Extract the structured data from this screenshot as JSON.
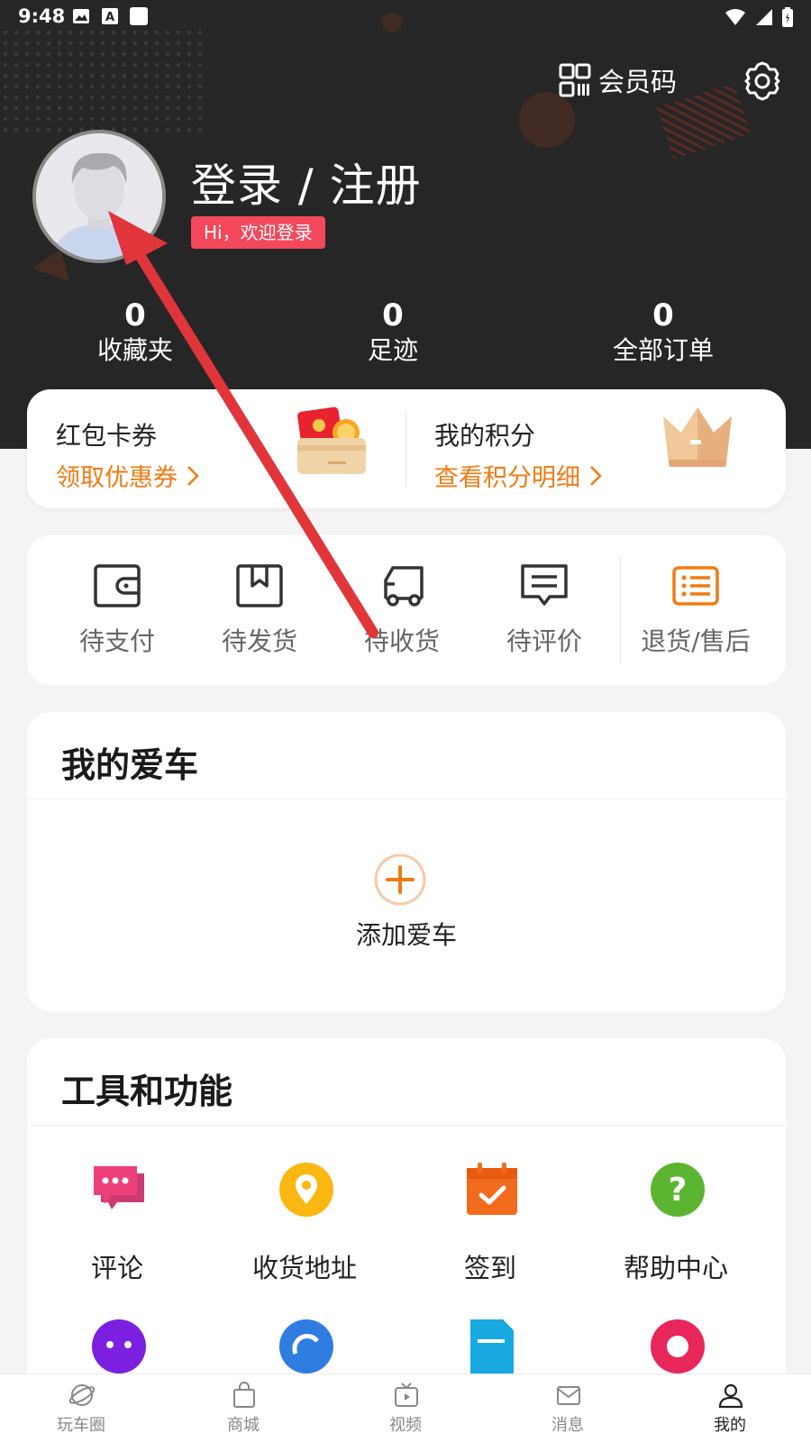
{
  "status_bar": {
    "time": "9:48"
  },
  "header": {
    "member_code": "会员码",
    "login_title": "登录 / 注册",
    "welcome": "Hi，欢迎登录"
  },
  "stats": [
    {
      "value": "0",
      "label": "收藏夹"
    },
    {
      "value": "0",
      "label": "足迹"
    },
    {
      "value": "0",
      "label": "全部订单"
    }
  ],
  "wallet": {
    "coupons": {
      "title": "红包卡券",
      "link": "领取优惠券"
    },
    "points": {
      "title": "我的积分",
      "link": "查看积分明细"
    }
  },
  "orders": [
    {
      "label": "待支付",
      "icon": "wallet-icon"
    },
    {
      "label": "待发货",
      "icon": "package-icon"
    },
    {
      "label": "待收货",
      "icon": "truck-icon"
    },
    {
      "label": "待评价",
      "icon": "comment-icon"
    },
    {
      "label": "退货/售后",
      "icon": "list-icon"
    }
  ],
  "my_car": {
    "title": "我的爱车",
    "add_label": "添加爱车"
  },
  "tools": {
    "title": "工具和功能",
    "items": [
      {
        "label": "评论",
        "icon": "chat-icon"
      },
      {
        "label": "收货地址",
        "icon": "location-icon"
      },
      {
        "label": "签到",
        "icon": "calendar-check-icon"
      },
      {
        "label": "帮助中心",
        "icon": "help-icon"
      }
    ]
  },
  "tabbar": [
    {
      "label": "玩车圈",
      "icon": "planet-icon"
    },
    {
      "label": "商城",
      "icon": "shopping-bag-icon"
    },
    {
      "label": "视频",
      "icon": "tv-icon"
    },
    {
      "label": "消息",
      "icon": "mail-icon"
    },
    {
      "label": "我的",
      "icon": "person-icon",
      "active": true
    }
  ],
  "colors": {
    "accent": "#f07b14",
    "header_bg": "#262626",
    "badge": "#f2485a",
    "annotation_arrow": "#e0363b"
  }
}
